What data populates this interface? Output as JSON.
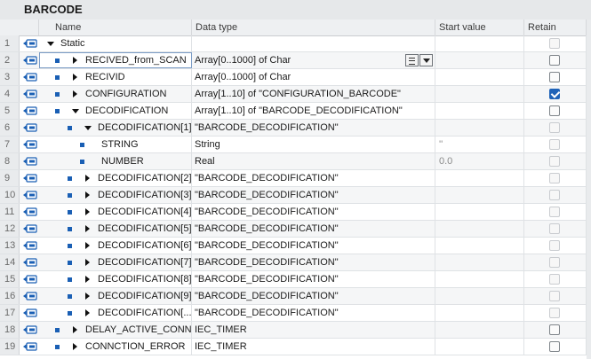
{
  "window": {
    "title": "BARCODE"
  },
  "columns": {
    "name": "Name",
    "data_type": "Data type",
    "start_value": "Start value",
    "retain": "Retain"
  },
  "rows": [
    {
      "num": "1",
      "level": 0,
      "expander": "down",
      "dot": false,
      "name": "Static",
      "type": "",
      "start": "",
      "retain": "disabled"
    },
    {
      "num": "2",
      "level": 1,
      "expander": "right",
      "dot": true,
      "name": "RECIVED_from_SCAN",
      "type": "Array[0..1000] of Char",
      "start": "",
      "retain": "unchecked",
      "selected": true
    },
    {
      "num": "3",
      "level": 1,
      "expander": "right",
      "dot": true,
      "name": "RECIVID",
      "type": "Array[0..1000] of Char",
      "start": "",
      "retain": "unchecked"
    },
    {
      "num": "4",
      "level": 1,
      "expander": "right",
      "dot": true,
      "name": "CONFIGURATION",
      "type": "Array[1..10] of \"CONFIGURATION_BARCODE\"",
      "start": "",
      "retain": "checked"
    },
    {
      "num": "5",
      "level": 1,
      "expander": "down",
      "dot": true,
      "name": "DECODIFICATION",
      "type": "Array[1..10] of \"BARCODE_DECODIFICATION\"",
      "start": "",
      "retain": "unchecked"
    },
    {
      "num": "6",
      "level": 2,
      "expander": "down",
      "dot": true,
      "name": "DECODIFICATION[1]",
      "type": "\"BARCODE_DECODIFICATION\"",
      "start": "",
      "retain": "disabled"
    },
    {
      "num": "7",
      "level": 3,
      "expander": "none",
      "dot": true,
      "name": "STRING",
      "type": "String",
      "start": "''",
      "retain": "disabled"
    },
    {
      "num": "8",
      "level": 3,
      "expander": "none",
      "dot": true,
      "name": "NUMBER",
      "type": "Real",
      "start": "0.0",
      "retain": "disabled"
    },
    {
      "num": "9",
      "level": 2,
      "expander": "right",
      "dot": true,
      "name": "DECODIFICATION[2]",
      "type": "\"BARCODE_DECODIFICATION\"",
      "start": "",
      "retain": "disabled"
    },
    {
      "num": "10",
      "level": 2,
      "expander": "right",
      "dot": true,
      "name": "DECODIFICATION[3]",
      "type": "\"BARCODE_DECODIFICATION\"",
      "start": "",
      "retain": "disabled"
    },
    {
      "num": "11",
      "level": 2,
      "expander": "right",
      "dot": true,
      "name": "DECODIFICATION[4]",
      "type": "\"BARCODE_DECODIFICATION\"",
      "start": "",
      "retain": "disabled"
    },
    {
      "num": "12",
      "level": 2,
      "expander": "right",
      "dot": true,
      "name": "DECODIFICATION[5]",
      "type": "\"BARCODE_DECODIFICATION\"",
      "start": "",
      "retain": "disabled"
    },
    {
      "num": "13",
      "level": 2,
      "expander": "right",
      "dot": true,
      "name": "DECODIFICATION[6]",
      "type": "\"BARCODE_DECODIFICATION\"",
      "start": "",
      "retain": "disabled"
    },
    {
      "num": "14",
      "level": 2,
      "expander": "right",
      "dot": true,
      "name": "DECODIFICATION[7]",
      "type": "\"BARCODE_DECODIFICATION\"",
      "start": "",
      "retain": "disabled"
    },
    {
      "num": "15",
      "level": 2,
      "expander": "right",
      "dot": true,
      "name": "DECODIFICATION[8]",
      "type": "\"BARCODE_DECODIFICATION\"",
      "start": "",
      "retain": "disabled"
    },
    {
      "num": "16",
      "level": 2,
      "expander": "right",
      "dot": true,
      "name": "DECODIFICATION[9]",
      "type": "\"BARCODE_DECODIFICATION\"",
      "start": "",
      "retain": "disabled"
    },
    {
      "num": "17",
      "level": 2,
      "expander": "right",
      "dot": true,
      "name": "DECODIFICATION[...",
      "type": "\"BARCODE_DECODIFICATION\"",
      "start": "",
      "retain": "disabled"
    },
    {
      "num": "18",
      "level": 1,
      "expander": "right",
      "dot": true,
      "name": "DELAY_ACTIVE_CONN...",
      "type": "IEC_TIMER",
      "start": "",
      "retain": "unchecked"
    },
    {
      "num": "19",
      "level": 1,
      "expander": "right",
      "dot": true,
      "name": "CONNCTION_ERROR",
      "type": "IEC_TIMER",
      "start": "",
      "retain": "unchecked"
    }
  ],
  "icons": {
    "interface": "interface-tag-icon",
    "list": "list-icon",
    "dropdown": "chevron-down-icon"
  },
  "colors": {
    "accent": "#1f63b8",
    "member_dot": "#1a5fb4",
    "interface_icon": "#1a5fb4"
  }
}
